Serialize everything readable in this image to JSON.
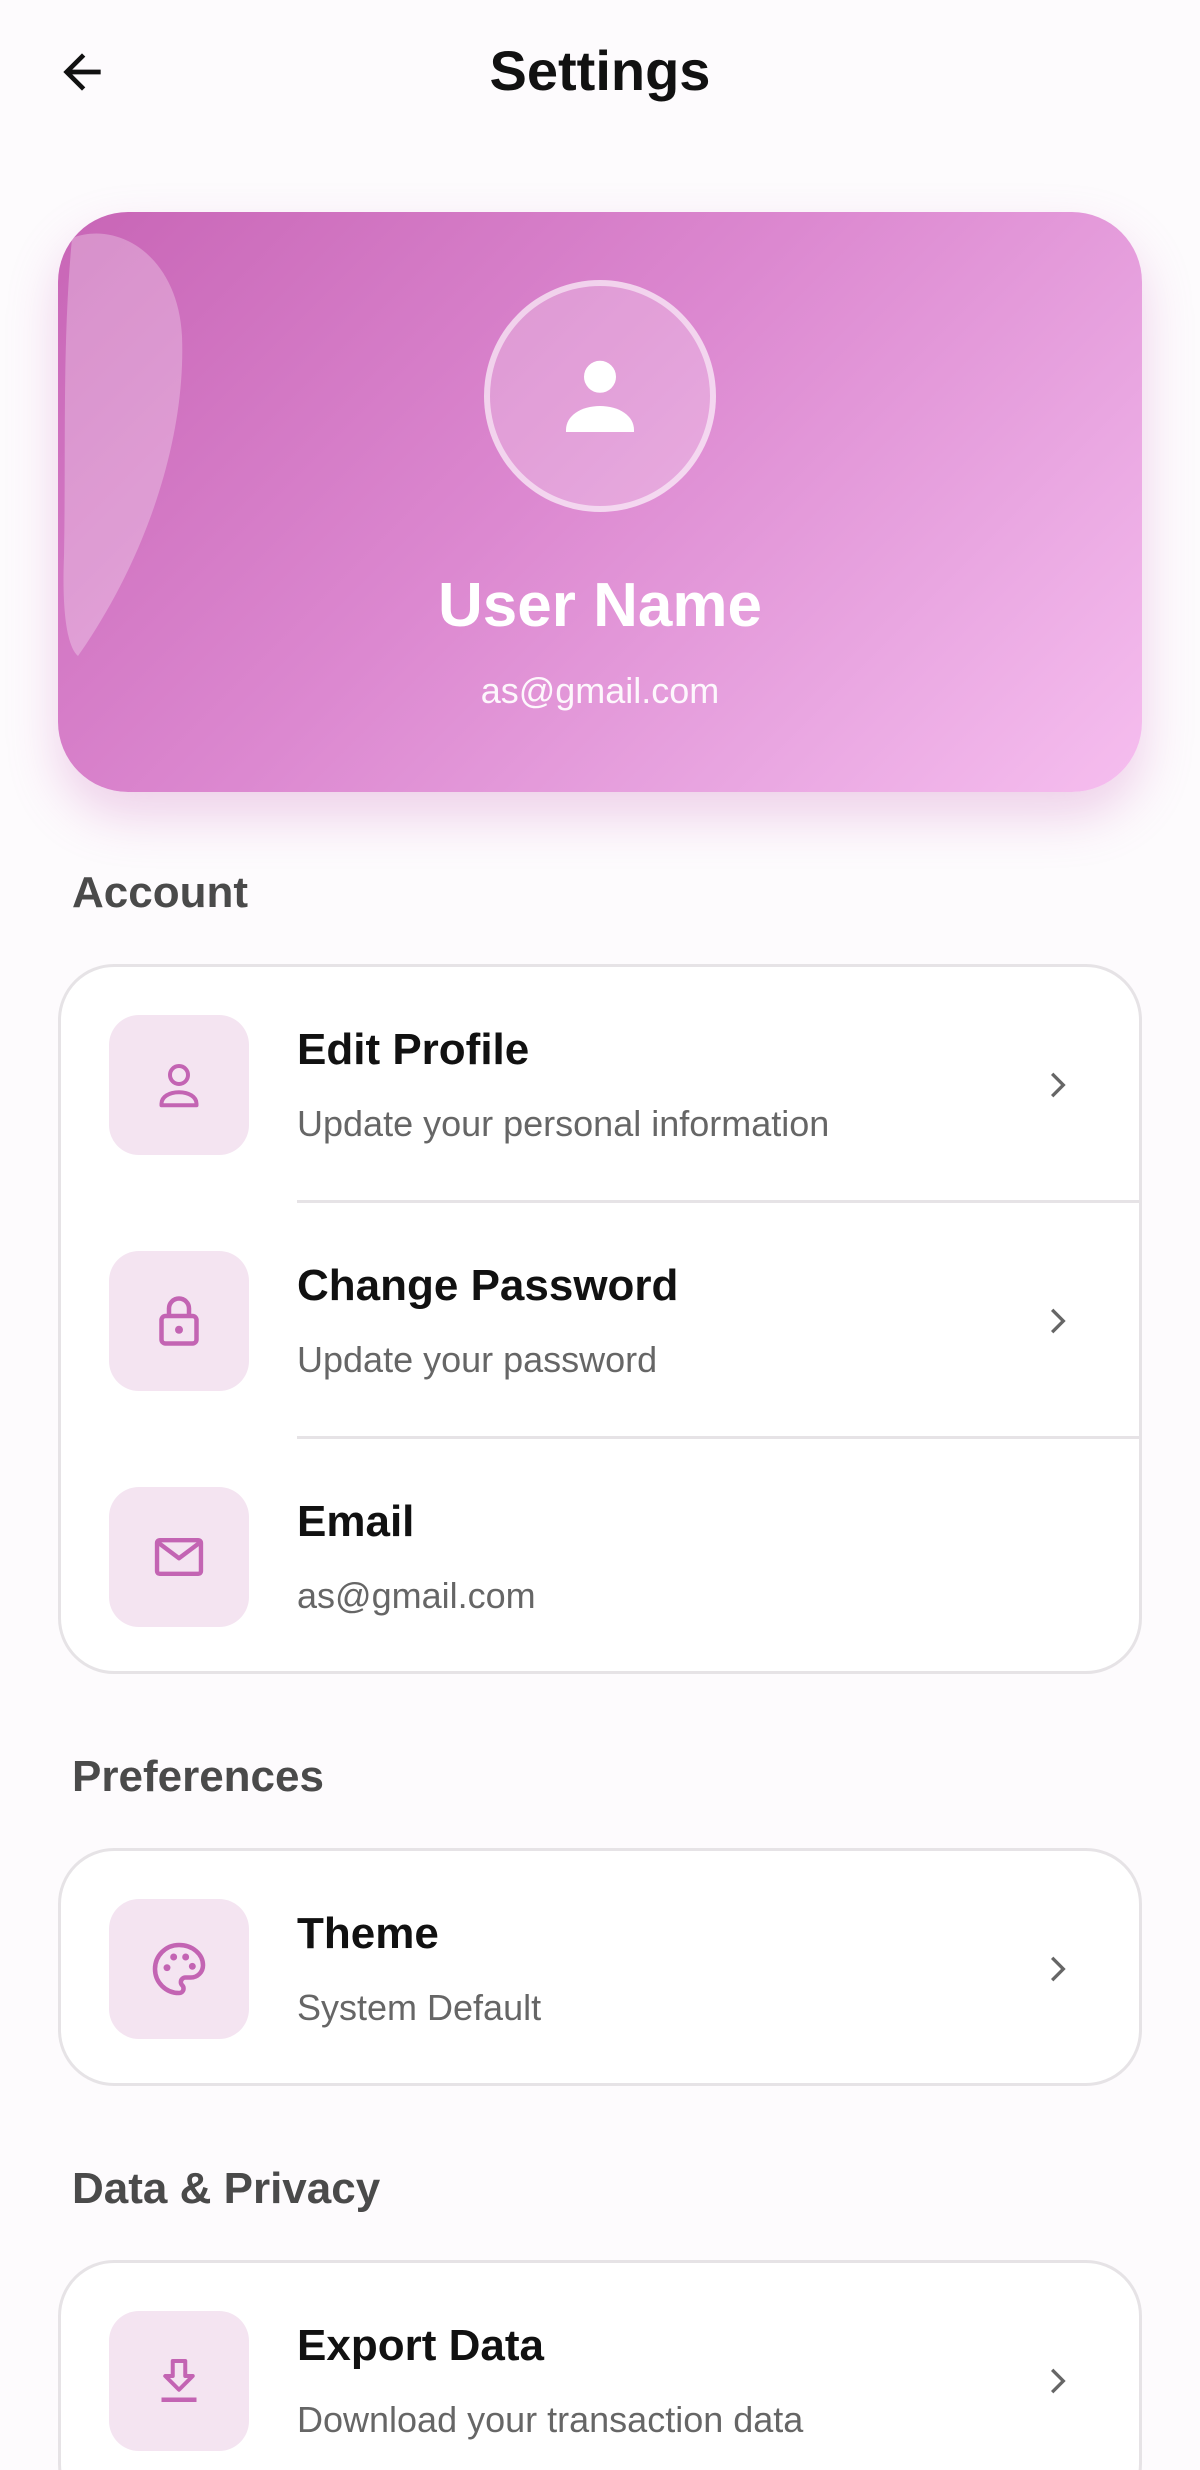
{
  "header": {
    "title": "Settings",
    "back_icon": "arrow-left-icon"
  },
  "profile": {
    "name": "User Name",
    "email": "as@gmail.com",
    "avatar_icon": "person-icon",
    "gradient": [
      "#c865b6",
      "#f6beef"
    ]
  },
  "sections": {
    "account": {
      "title": "Account",
      "items": [
        {
          "title": "Edit Profile",
          "subtitle": "Update your personal information",
          "icon": "person-outline-icon",
          "chevron": true
        },
        {
          "title": "Change Password",
          "subtitle": "Update your password",
          "icon": "lock-icon",
          "chevron": true
        },
        {
          "title": "Email",
          "subtitle": "as@gmail.com",
          "icon": "mail-icon",
          "chevron": false
        }
      ]
    },
    "preferences": {
      "title": "Preferences",
      "items": [
        {
          "title": "Theme",
          "subtitle": "System Default",
          "icon": "palette-icon",
          "chevron": true
        }
      ]
    },
    "data_privacy": {
      "title": "Data & Privacy",
      "items": [
        {
          "title": "Export Data",
          "subtitle": "Download your transaction data",
          "icon": "download-icon",
          "chevron": true
        }
      ]
    }
  },
  "colors": {
    "accent": "#c364b3",
    "icon_tile": "#f4e4f1",
    "divider": "#e6e3e6",
    "subtitle": "#666666"
  }
}
